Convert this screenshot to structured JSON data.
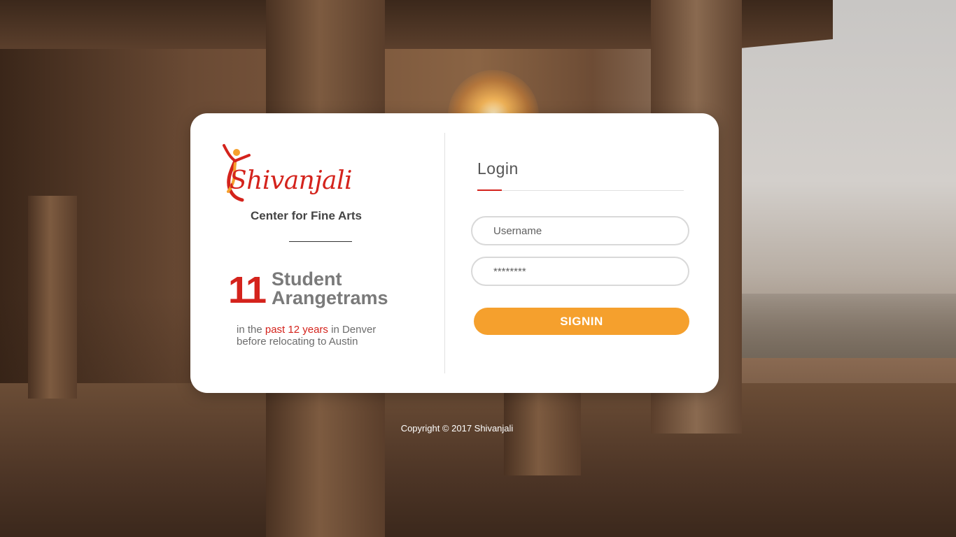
{
  "brand": {
    "name": "Shivanjali",
    "tagline": "Center for Fine Arts"
  },
  "stats": {
    "number": "11",
    "label": "Student Arangetrams",
    "desc_prefix": "in the ",
    "desc_highlight": "past 12 years",
    "desc_suffix": " in Denver before  relocating to Austin"
  },
  "login": {
    "title": "Login",
    "username_placeholder": "Username",
    "password_placeholder": "********",
    "signin_label": "SIGNIN"
  },
  "footer": {
    "copyright": "Copyright © 2017 Shivanjali"
  },
  "colors": {
    "accent_red": "#d4231c",
    "button_orange": "#f5a02d"
  }
}
